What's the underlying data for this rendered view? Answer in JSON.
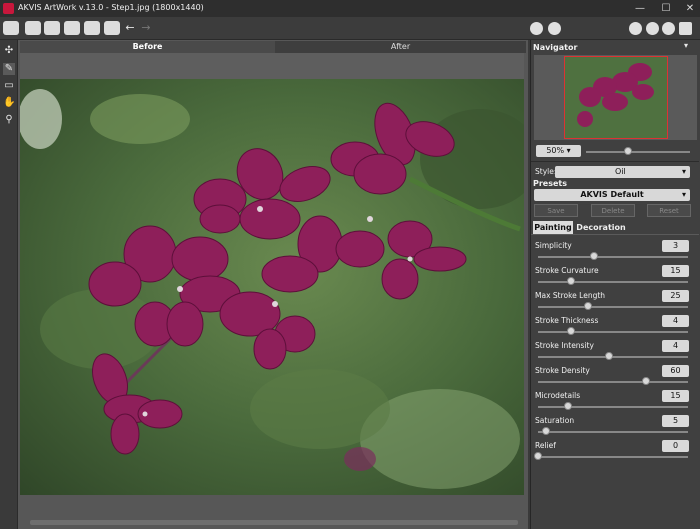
{
  "window": {
    "title": "AKVIS ArtWork v.13.0 - Step1.jpg (1800x1440)"
  },
  "canvas": {
    "tabs": [
      "Before",
      "After"
    ]
  },
  "navigator": {
    "title": "Navigator",
    "zoom": "50%"
  },
  "settings": {
    "style_label": "Style:",
    "style_value": "Oil",
    "presets_title": "Presets",
    "preset_value": "AKVIS Default",
    "buttons": [
      "Save",
      "Delete",
      "Reset"
    ],
    "tabs": [
      "Painting",
      "Decoration"
    ],
    "params": [
      {
        "label": "Simplicity",
        "value": "3",
        "level": 0.37
      },
      {
        "label": "Stroke Curvature",
        "value": "15",
        "level": 0.22
      },
      {
        "label": "Max Stroke Length",
        "value": "25",
        "level": 0.33
      },
      {
        "label": "Stroke Thickness",
        "value": "4",
        "level": 0.22
      },
      {
        "label": "Stroke Intensity",
        "value": "4",
        "level": 0.47
      },
      {
        "label": "Stroke Density",
        "value": "60",
        "level": 0.72
      },
      {
        "label": "Microdetails",
        "value": "15",
        "level": 0.2
      },
      {
        "label": "Saturation",
        "value": "5",
        "level": 0.05
      },
      {
        "label": "Relief",
        "value": "0",
        "level": 0.0
      }
    ]
  },
  "colors": {
    "accent": "#c8173c",
    "panel": "#404040",
    "orchid": "#8e1f5a"
  }
}
